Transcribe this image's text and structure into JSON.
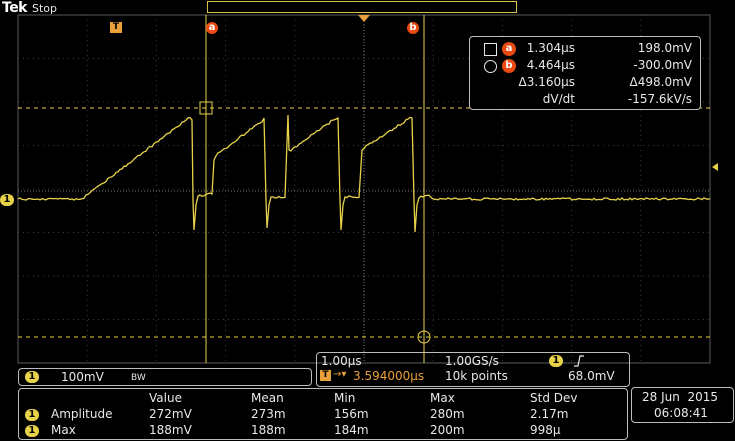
{
  "header": {
    "brand": "Tek",
    "status": "Stop"
  },
  "graticule_markers": {
    "trigger_position_label": "T",
    "cursor_a_label": "a",
    "cursor_b_label": "b",
    "channel_marker_label": "1"
  },
  "cursor_readout": {
    "rows": [
      {
        "symbol": "square-icon",
        "badge": "a",
        "time": "1.304µs",
        "value": "198.0mV"
      },
      {
        "symbol": "circle-icon",
        "badge": "b",
        "time": "4.464µs",
        "value": "-300.0mV"
      }
    ],
    "delta_time": "Δ3.160µs",
    "delta_value": "Δ498.0mV",
    "slope_label": "dV/dt",
    "slope_value": "-157.6kV/s"
  },
  "channel_info": {
    "channel": "1",
    "scale": "100mV",
    "bandwidth_limit": "BW"
  },
  "horizontal_info": {
    "time_per_div": "1.00µs",
    "sample_rate": "1.00GS/s",
    "trigger_source": "1",
    "trigger_slope": "rising-edge-icon",
    "trigger_tag": "T",
    "trigger_delay": "3.594000µs",
    "record_length": "10k points",
    "trigger_level": "68.0mV"
  },
  "measurements": {
    "headers": [
      "Value",
      "Mean",
      "Min",
      "Max",
      "Std Dev"
    ],
    "rows": [
      {
        "channel": "1",
        "name": "Amplitude",
        "values": [
          "272mV",
          "273m",
          "156m",
          "280m",
          "2.17m"
        ]
      },
      {
        "channel": "1",
        "name": "Max",
        "values": [
          "188mV",
          "188m",
          "184m",
          "200m",
          "998µ"
        ]
      }
    ]
  },
  "datetime": {
    "date": "28 Jun  2015",
    "time": "06:08:41"
  },
  "colors": {
    "trace": "#e8d24a",
    "grid": "#3d3d3d",
    "cursor_badge": "#e84a12",
    "trigger_marker": "#e8a03a",
    "panel_border": "#bdbdbd"
  }
}
